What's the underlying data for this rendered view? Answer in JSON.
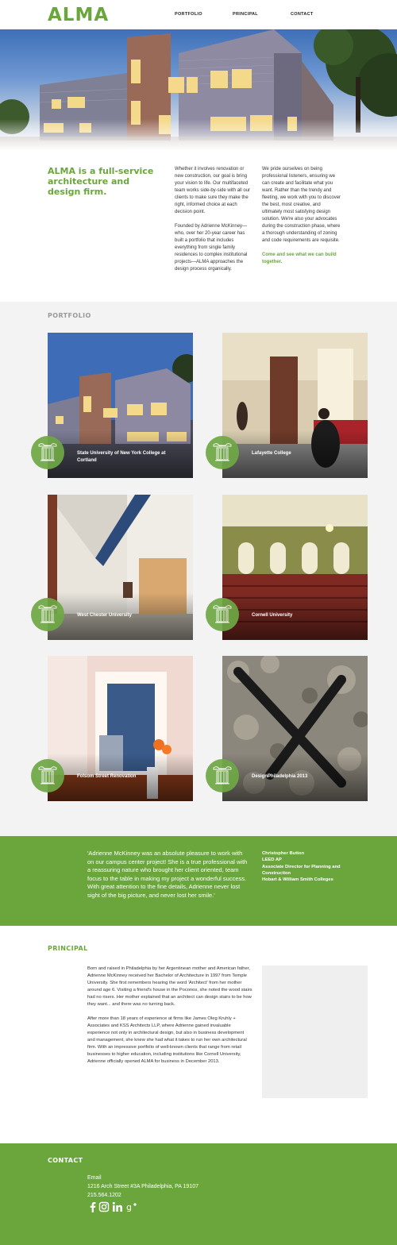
{
  "header": {
    "logo": "ALMA",
    "nav": [
      "PORTFOLIO",
      "PRINCIPAL",
      "CONTACT"
    ]
  },
  "intro": {
    "tagline": "ALMA is a full-service architecture and design firm.",
    "col1_p1": "Whether it involves renovation or new construction, our goal is bring your vision to life. Our multifaceted team works side-by-side with all our clients to make sure they make the right, informed choice at each decision point.",
    "col1_p2": "Founded by Adrienne McKinney—who, over her 20-year career has built a portfolio that includes everything from single family residences to complex institutional projects—ALMA approaches the design process organically.",
    "col2_p1": "We pride ourselves on being professional listeners, ensuring we can create and facilitate what you want. Rather than the trendy and fleeting, we work with you to discover the best, most creative, and ultimately most satisfying design solution. We're also your advocates during the construction phase, where a thorough understanding of zoning and code requirements are requisite.",
    "cta": "Come and see what we can build together."
  },
  "portfolio": {
    "title": "PORTFOLIO",
    "items": [
      {
        "label": "State University of New York College at Cortland"
      },
      {
        "label": "Lafayette College"
      },
      {
        "label": "West Chester University"
      },
      {
        "label": "Cornell University"
      },
      {
        "label": "Folsom Street Renovation"
      },
      {
        "label": "DesignPhiladelphia 2013"
      }
    ]
  },
  "testimonial": {
    "quote": "'Adrienne McKinney was an absolute pleasure to work with on our campus center project! She is a true professional with a reassuring nature who brought her client oriented, team focus to the table in making my project a wonderful success. With great attention to the fine details, Adrienne never lost sight of the big picture, and never lost her smile.'",
    "name": "Christopher Button",
    "credential": "LEED AP",
    "role": "Associate Director for Planning and Construction",
    "org": "Hobart & William Smith Colleges"
  },
  "principal": {
    "title": "PRINCIPAL",
    "bio_p1": "Born and raised in Philadelphia by her Argentinean mother and American father, Adrienne McKinney received her Bachelor of Architecture in 1997 from Temple University. She first remembers hearing the word 'Architect' from her mother around age 6. Visiting a friend's house in the Poconos, she noted the wood stairs had no risers. Her mother explained that an architect can design stairs to be how they want... and there was no turning back.",
    "bio_p2": "After more than 18 years of experience at firms like James Oleg Kruhly + Associates and KSS Architects LLP, where Adrienne gained invaluable experience not only in architectural design, but also in business development and management, she knew she had what it takes to run her own architectural firm. With an impressive portfolio of well-known clients that range from retail businesses to higher education, including institutions like Cornell University, Adrienne officially opened ALMA for business in December 2013."
  },
  "contact": {
    "title": "CONTACT",
    "email": "Email",
    "address": "1216 Arch Street #3A Philadelphia, PA 19107",
    "phone": "215.564.1202",
    "social": [
      "facebook-icon",
      "instagram-icon",
      "linkedin-icon",
      "google-plus-icon"
    ]
  },
  "colors": {
    "brand_green": "#6aa63b",
    "portfolio_bg": "#f3f3f3"
  }
}
